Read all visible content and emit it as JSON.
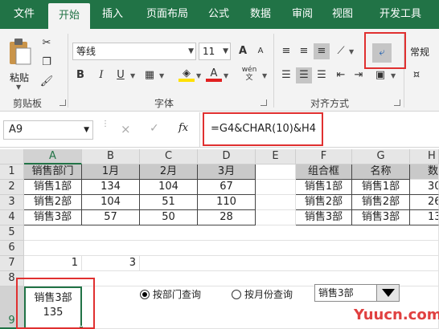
{
  "ribbon_tabs": [
    "文件",
    "开始",
    "插入",
    "页面布局",
    "公式",
    "数据",
    "审阅",
    "视图",
    "开发工具"
  ],
  "clipboard": {
    "paste_label": "粘贴",
    "group_label": "剪贴板"
  },
  "font": {
    "family": "等线",
    "size": "11",
    "group_label": "字体",
    "bold": "B",
    "italic": "I",
    "underline": "U",
    "grow": "A",
    "shrink": "A",
    "color_a": "A",
    "phonetic": "wén"
  },
  "alignment": {
    "group_label": "对齐方式"
  },
  "number": {
    "format": "常规"
  },
  "formula_bar": {
    "name_box": "A9",
    "cancel": "×",
    "enter": "✓",
    "fx": "fx",
    "formula": "=G4&CHAR(10)&H4"
  },
  "grid": {
    "columns": [
      "A",
      "B",
      "C",
      "D",
      "E",
      "F",
      "G",
      "H"
    ],
    "rows": [
      "1",
      "2",
      "3",
      "4",
      "5",
      "6",
      "7",
      "8",
      "9"
    ],
    "A1": "销售部门",
    "B1": "1月",
    "C1": "2月",
    "D1": "3月",
    "A2": "销售1部",
    "B2": "134",
    "C2": "104",
    "D2": "67",
    "A3": "销售2部",
    "B3": "104",
    "C3": "51",
    "D3": "110",
    "A4": "销售3部",
    "B4": "57",
    "C4": "50",
    "D4": "28",
    "F1": "组合框",
    "G1": "名称",
    "H1": "数",
    "F2": "销售1部",
    "G2": "销售1部",
    "H2": "30",
    "F3": "销售2部",
    "G3": "销售2部",
    "H3": "26",
    "F4": "销售3部",
    "G4": "销售3部",
    "H4": "13",
    "A7": "1",
    "B7": "3",
    "A9_line1": "销售3部",
    "A9_line2": "135"
  },
  "controls": {
    "radio_dept": "按部门查询",
    "radio_month": "按月份查询",
    "dropdown_value": "销售3部"
  },
  "watermark": "Yuucn.com",
  "colors": {
    "ribbon_green": "#217346",
    "highlight_red": "#e03030"
  }
}
